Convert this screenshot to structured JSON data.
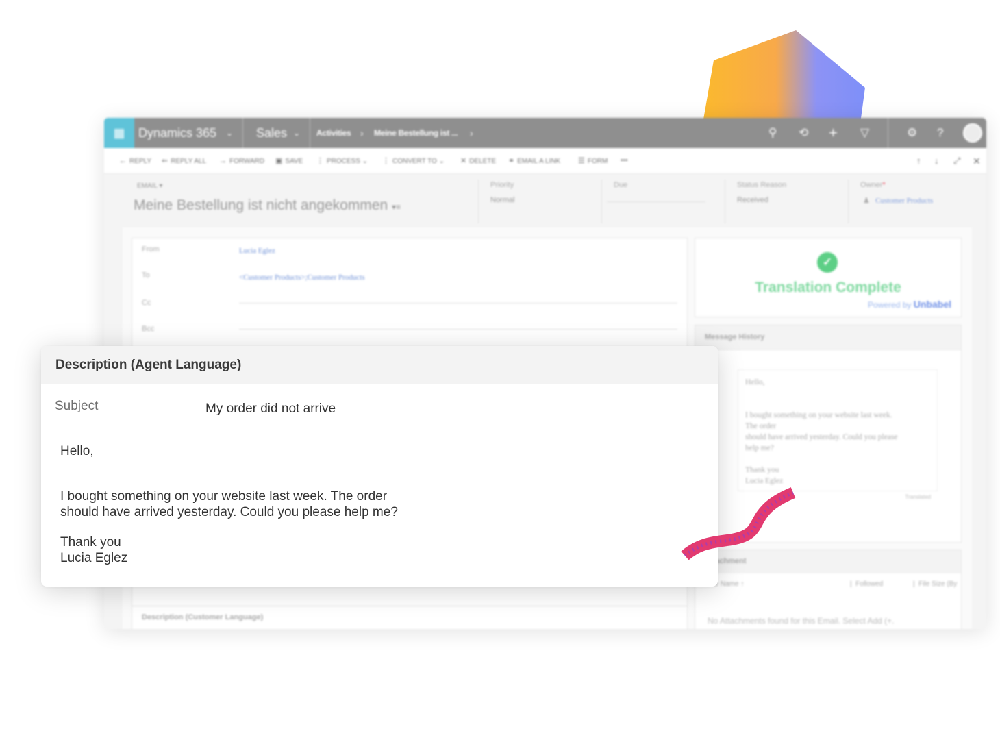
{
  "topbar": {
    "app_name": "Dynamics 365",
    "area": "Sales",
    "breadcrumb_1": "Activities",
    "breadcrumb_sep": "›",
    "breadcrumb_2": "Meine Bestellung ist ...",
    "chevron": "›"
  },
  "commands": {
    "reply": "Reply",
    "reply_all": "Reply All",
    "forward": "Forward",
    "save": "Save",
    "process": "Process",
    "convert_to": "Convert To",
    "delete": "Delete",
    "email_link": "Email a Link",
    "form": "Form",
    "more": "•••"
  },
  "record": {
    "type": "EMAIL ▾",
    "title": "Meine Bestellung ist nicht angekommen",
    "priority_label": "Priority",
    "priority_value": "Normal",
    "due_label": "Due",
    "status_label": "Status Reason",
    "status_value": "Received",
    "owner_label": "Owner",
    "owner_required": "*",
    "owner_value": "Customer Products"
  },
  "email": {
    "from_label": "From",
    "from_value": "Lucia Eglez",
    "to_label": "To",
    "to_value": "<Customer Products>;Customer Products",
    "cc_label": "Cc",
    "bcc_label": "Bcc"
  },
  "customer_desc_label": "Description (Customer Language)",
  "translation": {
    "title": "Translation Complete",
    "powered_by": "Powered by",
    "brand": "Unbabel",
    "check_glyph": "✓",
    "accent_color": "#5dcf86"
  },
  "history": {
    "title": "Message History",
    "lines": [
      "Hello,",
      "",
      "I bought something on your website last week.",
      "The order",
      "should have arrived yesterday. Could you please",
      "help me?",
      "",
      "Thank you",
      "Lucia Eglez"
    ],
    "translated_tag": "Translated"
  },
  "attachments": {
    "title": "Attachment",
    "col_name": "File Name ↑",
    "col_followed": "Followed",
    "col_size": "File Size (By",
    "empty_text": "No Attachments found for this Email. Select Add (+."
  },
  "card": {
    "title": "Description (Agent Language)",
    "subject_label": "Subject",
    "subject_value": "My order did not arrive",
    "greeting": "Hello,",
    "body_line_1": "I bought something on your website last week. The order",
    "body_line_2": "should have arrived yesterday. Could you please help me?",
    "closing": "Thank you",
    "signature": "Lucia Eglez"
  }
}
